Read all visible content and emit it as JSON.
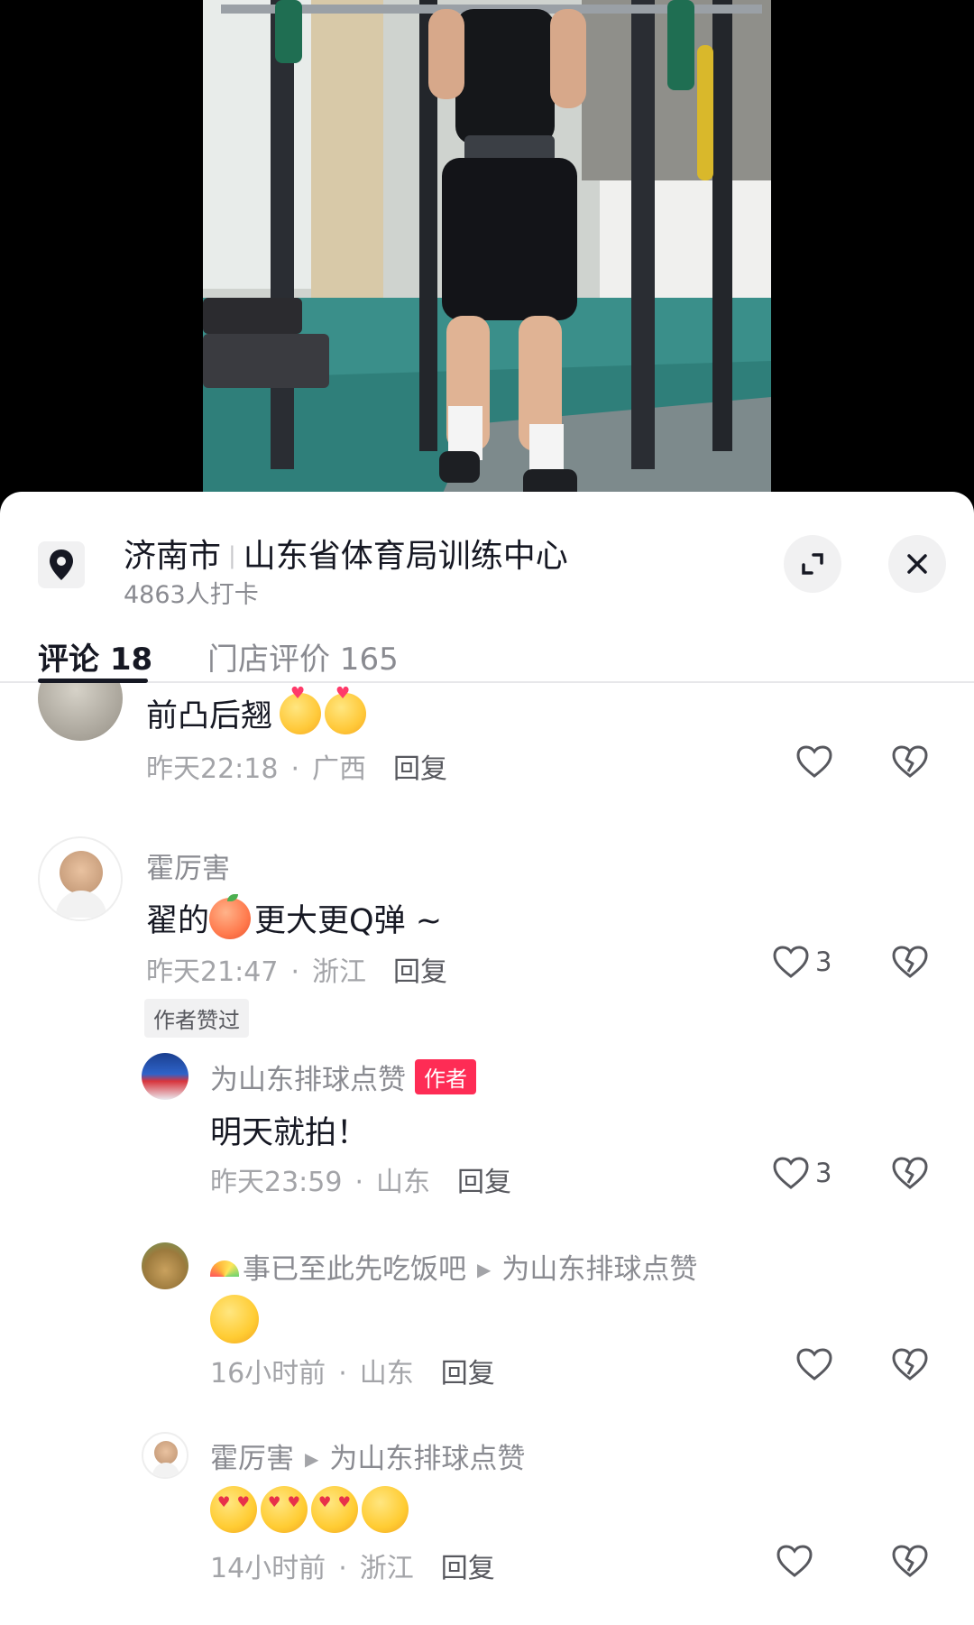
{
  "location": {
    "city": "济南市",
    "place": "山东省体育局训练中心",
    "checkins": "4863人打卡"
  },
  "tabs": {
    "comments": "评论 18",
    "reviews": "门店评价 165"
  },
  "icons": {
    "location": "location-pin-icon",
    "expand": "expand-icon",
    "close": "close-icon",
    "like": "heart-outline-icon",
    "dislike": "broken-heart-icon"
  },
  "colors": {
    "accent": "#fe2c55",
    "text_primary": "#161823",
    "text_secondary": "#8a8b91"
  },
  "comments": [
    {
      "text": "前凸后翘",
      "time": "昨天22:18",
      "region": "广西",
      "reply": "回复",
      "likes": ""
    },
    {
      "name": "霍厉害",
      "text_before": "翟的",
      "text_after": "更大更Q弹 ~",
      "time": "昨天21:47",
      "region": "浙江",
      "reply": "回复",
      "likes": "3",
      "badge": "作者赞过"
    },
    {
      "name": "为山东排球点赞",
      "author_tag": "作者",
      "text": "明天就拍！",
      "time": "昨天23:59",
      "region": "山东",
      "reply": "回复",
      "likes": "3"
    },
    {
      "name": "事已至此先吃饭吧",
      "reply_to": "为山东排球点赞",
      "time": "16小时前",
      "region": "山东",
      "reply": "回复",
      "likes": ""
    },
    {
      "name": "霍厉害",
      "reply_to": "为山东排球点赞",
      "time": "14小时前",
      "region": "浙江",
      "reply": "回复",
      "likes": ""
    }
  ]
}
